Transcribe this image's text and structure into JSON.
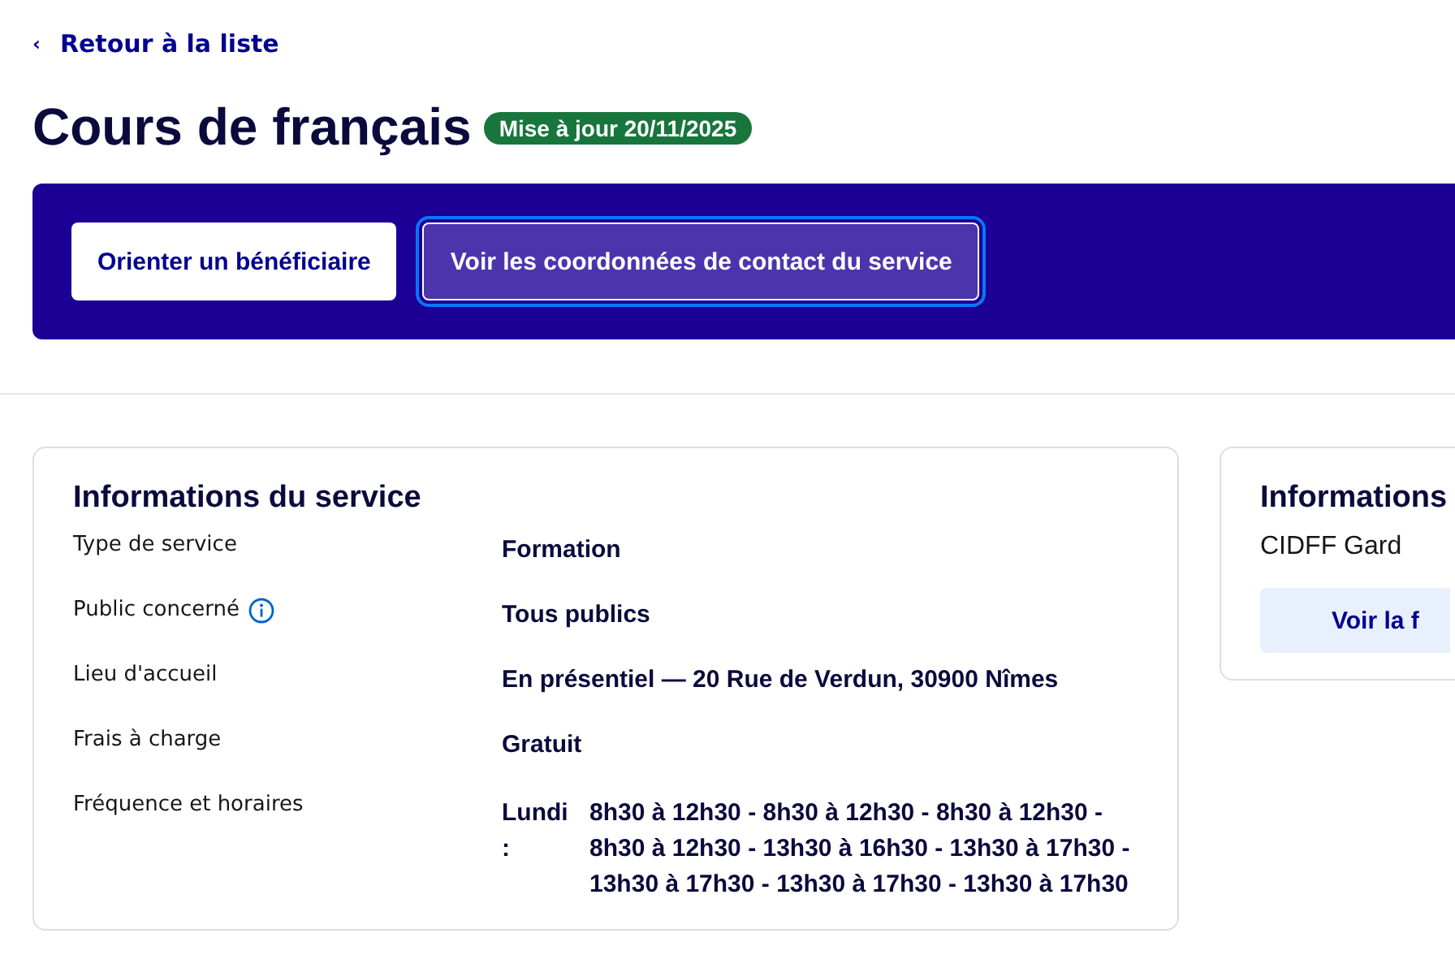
{
  "back_link": {
    "icon": "‹",
    "label": "Retour à la liste"
  },
  "title": "Cours de français",
  "badge": "Mise à jour 20/11/2025",
  "actions": [
    {
      "label": "Orienter un bénéficiaire",
      "kind": "primary",
      "focused": false
    },
    {
      "label": "Voir les coordonnées de contact du service",
      "kind": "secondary",
      "focused": true
    }
  ],
  "service_card": {
    "title": "Informations du service",
    "rows": [
      {
        "label": "Type de service",
        "value": "Formation",
        "info": false
      },
      {
        "label": "Public concerné",
        "value": "Tous publics",
        "info": true
      },
      {
        "label": "Lieu d'accueil",
        "value": "En présentiel — 20 Rue de Verdun, 30900 Nîmes",
        "info": false
      },
      {
        "label": "Frais à charge",
        "value": "Gratuit",
        "info": false
      }
    ],
    "schedule": {
      "label": "Fréquence et horaires",
      "day": "Lundi :",
      "hours": "8h30 à 12h30 - 8h30 à 12h30 - 8h30 à 12h30 - 8h30 à 12h30 - 13h30 à 16h30 - 13h30 à 17h30 - 13h30 à 17h30 - 13h30 à 17h30 - 13h30 à 17h30"
    }
  },
  "structure_card": {
    "title": "Informations",
    "name": "CIDFF Gard",
    "button": "Voir la f"
  }
}
